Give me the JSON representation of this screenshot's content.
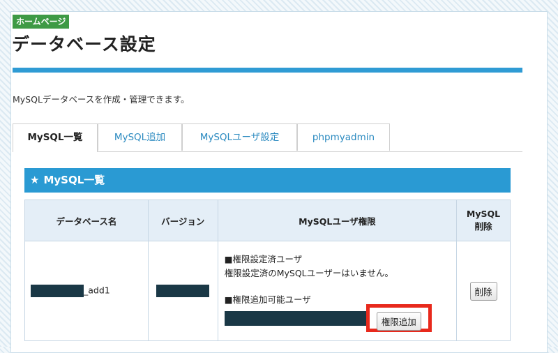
{
  "header": {
    "badge": "ホームページ",
    "title": "データベース設定",
    "description": "MySQLデータベースを作成・管理できます。"
  },
  "tabs": [
    {
      "label": "MySQL一覧",
      "active": true
    },
    {
      "label": "MySQL追加",
      "active": false
    },
    {
      "label": "MySQLユーザ設定",
      "active": false
    },
    {
      "label": "phpmyadmin",
      "active": false
    }
  ],
  "section": {
    "icon": "star-icon",
    "title": "MySQL一覧"
  },
  "table": {
    "columns": {
      "dbname": "データベース名",
      "version": "バージョン",
      "permissions": "MySQLユーザ権限",
      "delete_line1": "MySQL",
      "delete_line2": "削除"
    },
    "rows": [
      {
        "dbname_suffix": "_add1",
        "perm_set_heading": "■権限設定済ユーザ",
        "perm_set_text": "権限設定済のMySQLユーザーはいません。",
        "perm_add_heading": "■権限追加可能ユーザ",
        "add_button": "権限追加",
        "delete_button": "削除"
      }
    ]
  },
  "colors": {
    "accent": "#2a9ad3",
    "badge": "#3e9a45",
    "highlight": "#e8291c",
    "redaction": "#1a3846"
  }
}
